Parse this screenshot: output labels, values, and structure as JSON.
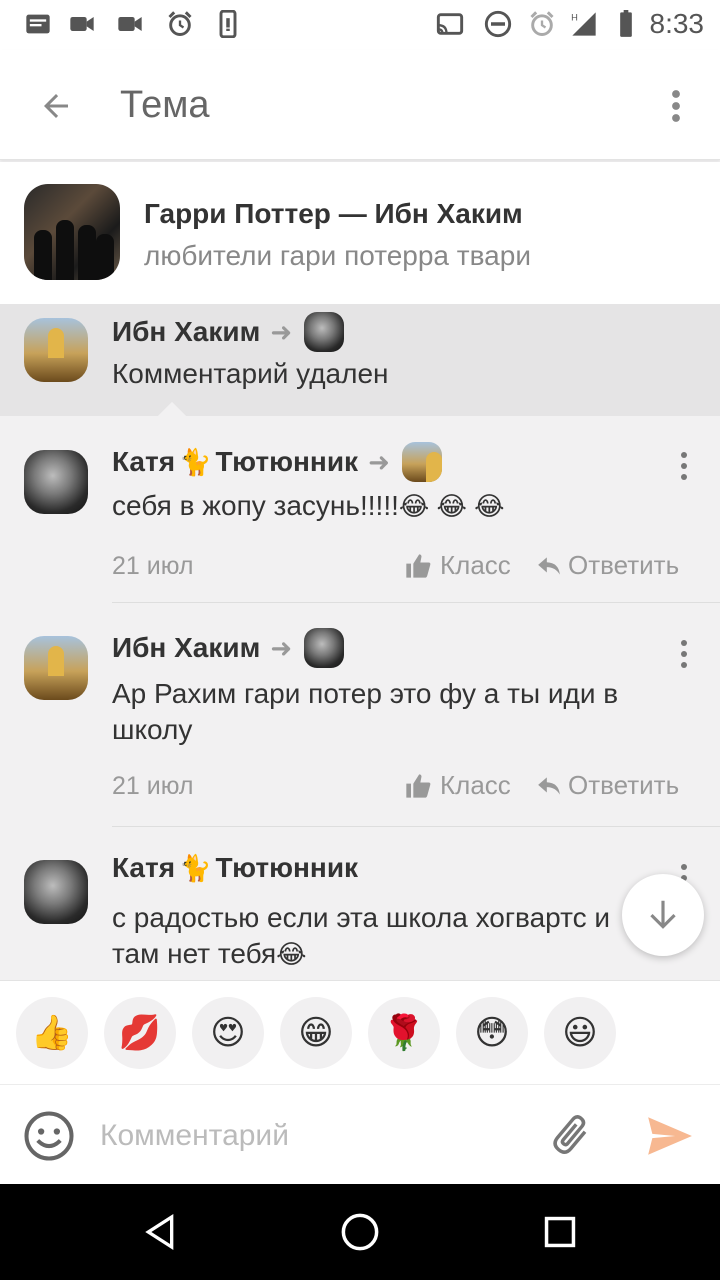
{
  "status_bar": {
    "time": "8:33",
    "icons": [
      "notes-icon",
      "video-icon",
      "video-icon",
      "alarm-icon",
      "phone-icon",
      "cast-icon",
      "dnd-icon",
      "alarm-icon",
      "signal-icon",
      "battery-icon"
    ]
  },
  "toolbar": {
    "title": "Тема",
    "back_icon": "arrow-left-icon",
    "menu_icon": "more-vert-icon"
  },
  "topic": {
    "title": "Гарри Поттер — Ибн Хаким",
    "subtitle": "любители гари потерра твари"
  },
  "comments": [
    {
      "author": "Ибн Хаким",
      "reply_to_avatar": "girl",
      "avatar": "mosque",
      "text": "Комментарий удален",
      "highlight": true
    },
    {
      "author_first": "Катя",
      "author_last": "Тютюнник",
      "cat_emoji": "🐈",
      "avatar": "girl",
      "reply_to_avatar": "mosque",
      "text": "себя в жопу засунь!!!!!",
      "emojis": "😂 😂 😂",
      "date": "21 июл",
      "class_label": "Класс",
      "reply_label": "Ответить"
    },
    {
      "author": "Ибн Хаким",
      "avatar": "mosque",
      "reply_to_avatar": "girl",
      "text": "Ар Рахим  гари потер это фу а ты иди в школу",
      "date": "21 июл",
      "class_label": "Класс",
      "reply_label": "Ответить"
    },
    {
      "author_first": "Катя",
      "author_last": "Тютюнник",
      "cat_emoji": "🐈",
      "avatar": "girl",
      "text": "с радостью если эта школа хогвартс и там нет тебя",
      "emojis": "😂"
    }
  ],
  "reactions": [
    "👍",
    "💋",
    "😍",
    "😁",
    "🌹",
    "😳",
    "😃"
  ],
  "input": {
    "placeholder": "Комментарий"
  },
  "nav": [
    "back-icon",
    "home-icon",
    "recents-icon"
  ]
}
